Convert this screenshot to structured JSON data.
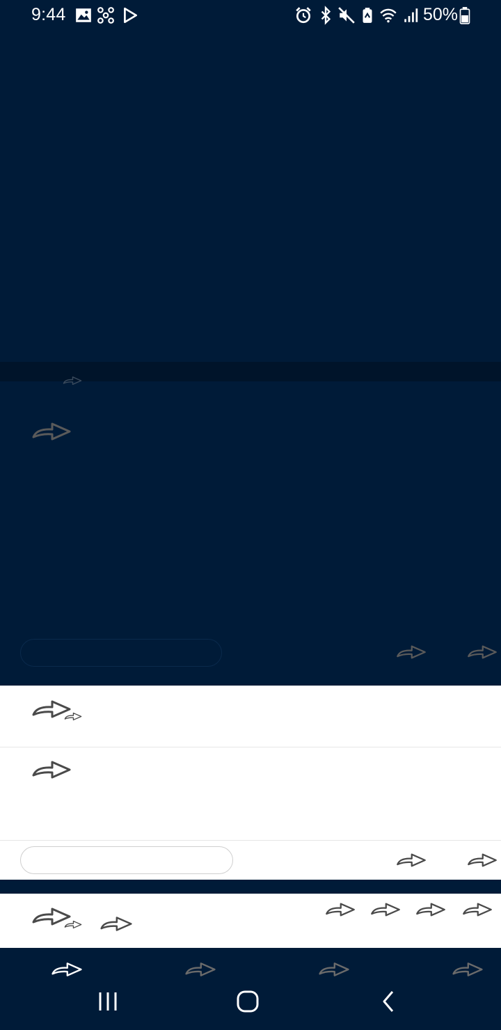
{
  "status_bar": {
    "time": "9:44",
    "battery_percent": "50%",
    "left_icons": [
      "image-icon",
      "pinwheel-icon",
      "play-icon"
    ],
    "right_icons": [
      "alarm-icon",
      "bluetooth-icon",
      "mute-icon",
      "battery-saver-icon",
      "wifi-icon",
      "signal-icon",
      "battery-icon"
    ]
  },
  "colors": {
    "background": "#001b38",
    "card": "#ffffff",
    "placeholder_icon_light": "#4a4a4a",
    "placeholder_icon_dark": "#555555",
    "active_nav": "#ffffff",
    "inactive_nav": "#6b6b6b"
  },
  "icons": {
    "placeholder": "share-arrow-icon"
  },
  "bottom_nav": {
    "items": [
      "nav-item-1",
      "nav-item-2",
      "nav-item-3",
      "nav-item-4"
    ],
    "active_index": 0
  },
  "system_nav": {
    "items": [
      "recents-icon",
      "home-icon",
      "back-icon"
    ]
  }
}
